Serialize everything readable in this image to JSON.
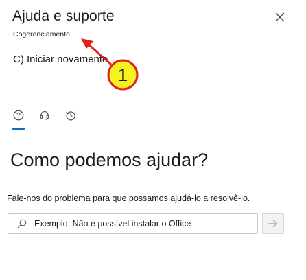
{
  "header": {
    "title": "Ajuda e suporte",
    "subtitle": "Cogerenciamento"
  },
  "step": {
    "text": "C) Iniciar novamente",
    "badge_number": "1"
  },
  "tabs": [
    {
      "icon": "help-circle-icon"
    },
    {
      "icon": "headset-icon"
    },
    {
      "icon": "history-icon"
    }
  ],
  "main": {
    "heading": "Como podemos ajudar?",
    "description": "Fale-nos do problema para que possamos ajudá-lo a resolvê-lo.",
    "search_placeholder": "Exemplo: Não é possível instalar o Office"
  },
  "colors": {
    "accent": "#0f6cbd",
    "annotation_red": "#e32020",
    "annotation_yellow": "#f7f21f"
  }
}
